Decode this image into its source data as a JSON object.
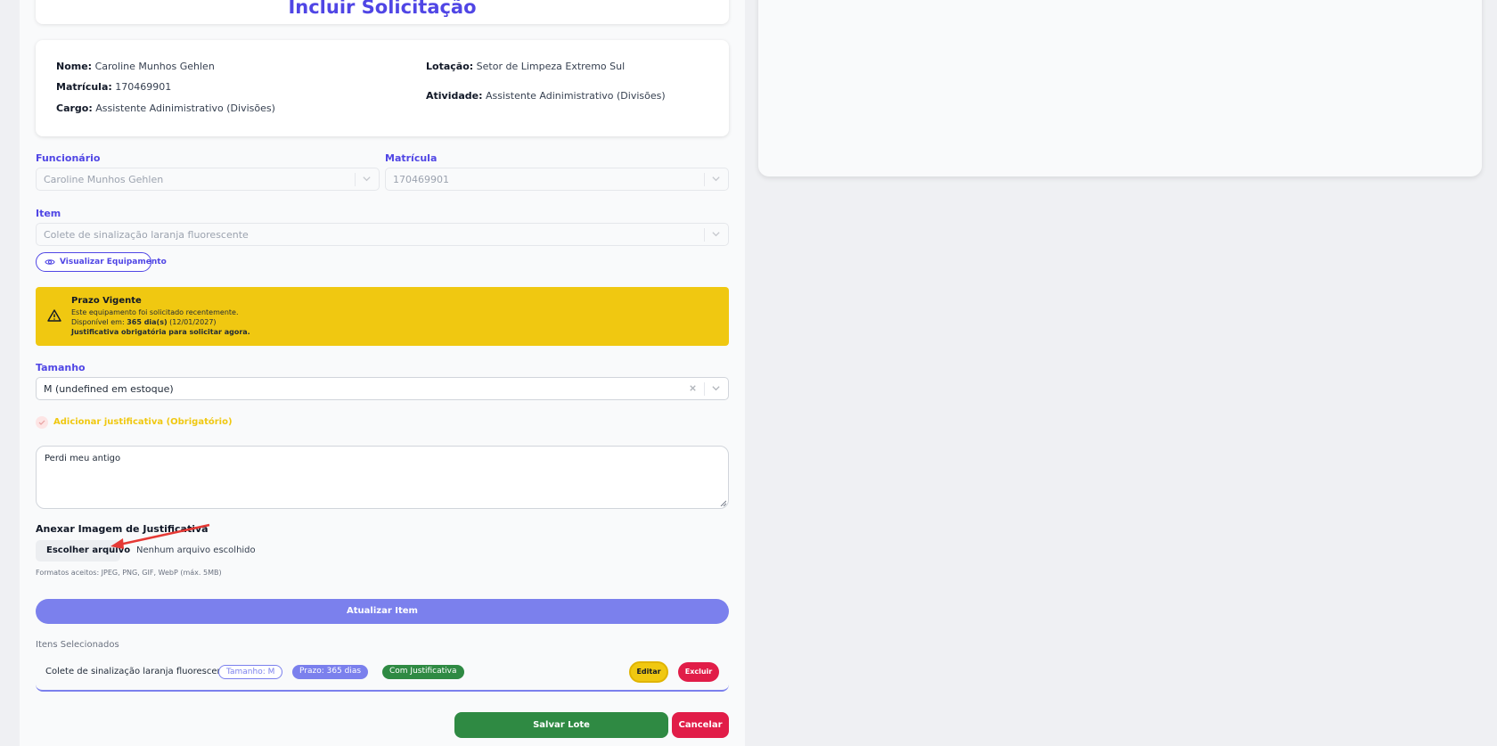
{
  "page": {
    "title": "Incluir Solicitação"
  },
  "employee_card": {
    "nome_label": "Nome:",
    "nome": "Caroline Munhos Gehlen",
    "matricula_label": "Matrícula:",
    "matricula": "170469901",
    "cargo_label": "Cargo:",
    "cargo": "Assistente Adinimistrativo (Divisões)",
    "lotacao_label": "Lotação:",
    "lotacao": "Setor de Limpeza Extremo Sul",
    "atividade_label": "Atividade:",
    "atividade": "Assistente Adinimistrativo (Divisões)"
  },
  "form": {
    "funcionario_label": "Funcionário",
    "funcionario_value": "Caroline Munhos Gehlen",
    "matricula_label": "Matrícula",
    "matricula_value": "170469901",
    "item_label": "Item",
    "item_value": "Colete de sinalização laranja fluorescente",
    "view_equipment_button": "Visualizar Equipamento",
    "tamanho_label": "Tamanho",
    "tamanho_value": "M (undefined em estoque)",
    "justificativa_checkbox_label": "Adicionar justificativa (Obrigatório)",
    "justificativa_text": "Perdi meu antigo",
    "attach_label": "Anexar Imagem de Justificativa",
    "file_button": "Escolher arquivo",
    "file_status": "Nenhum arquivo escolhido",
    "formats_hint": "Formatos aceitos: JPEG, PNG, GIF, WebP (máx. 5MB)",
    "update_button": "Atualizar Item"
  },
  "alert": {
    "title": "Prazo Vigente",
    "line1": "Este equipamento foi solicitado recentemente.",
    "line2_prefix": "Disponível em: ",
    "line2_days": "365 dia(s)",
    "line2_date": " (12/01/2027)",
    "line3": "Justificativa obrigatória para solicitar agora."
  },
  "selected_items": {
    "title": "Itens Selecionados",
    "items": [
      {
        "name": "Colete de sinalização laranja fluorescente",
        "size_badge": "Tamanho: M",
        "prazo_badge": "Prazo: 365 dias",
        "justificativa_badge": "Com Justificativa",
        "edit_label": "Editar",
        "delete_label": "Excluir"
      }
    ]
  },
  "footer": {
    "save_button": "Salvar Lote",
    "cancel_button": "Cancelar"
  },
  "colors": {
    "accent": "#5046e5",
    "warning": "#f0c811",
    "success": "#2f8a43",
    "danger": "#e11d48",
    "soft_accent": "#7b80ed"
  }
}
